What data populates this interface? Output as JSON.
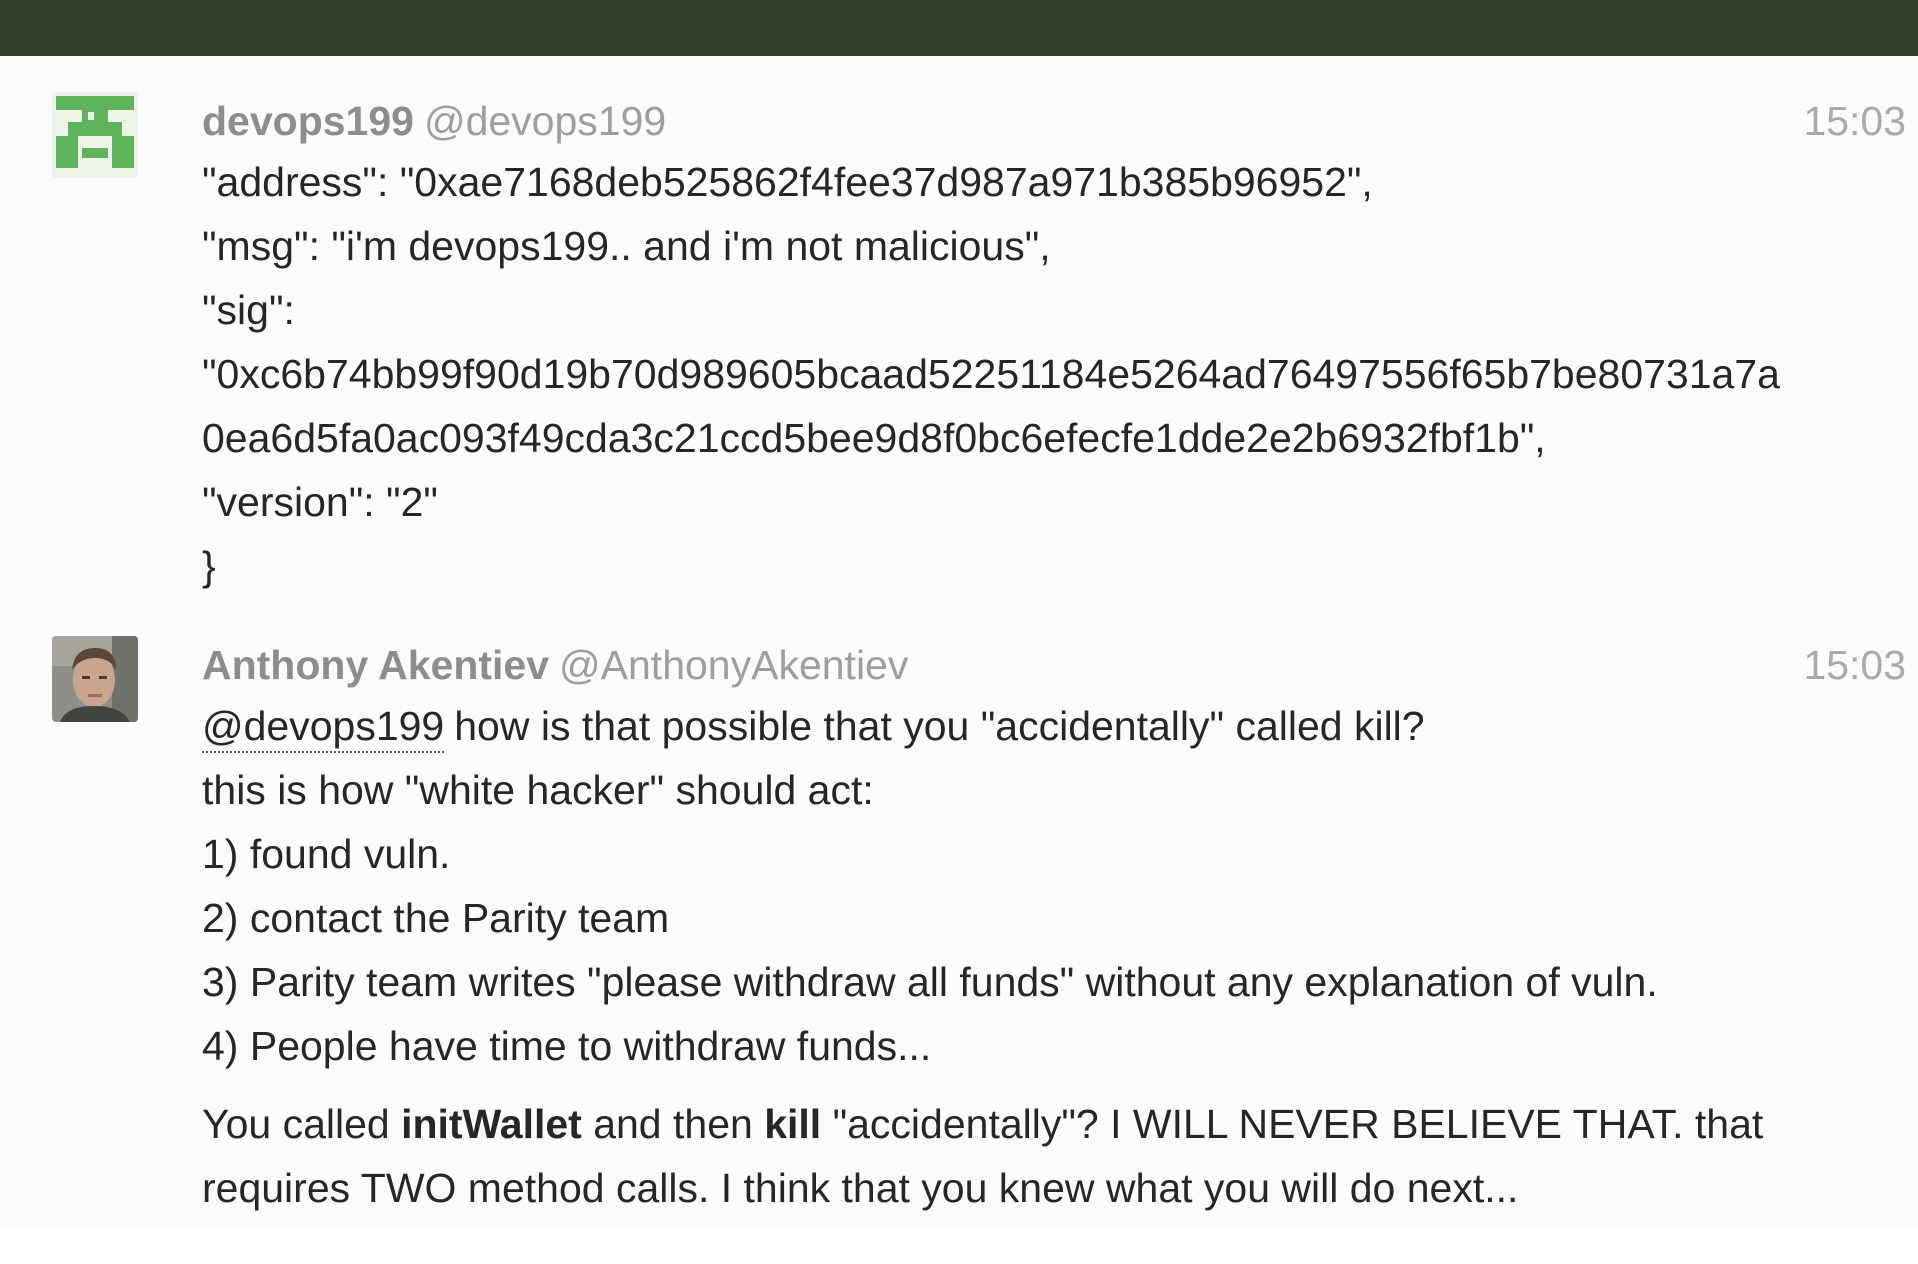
{
  "messages": [
    {
      "username": "devops199",
      "handle": "@devops199",
      "time": "15:03",
      "avatar": "identicon-avatar",
      "lines": [
        "\"address\": \"0xae7168deb525862f4fee37d987a971b385b96952\",",
        "\"msg\": \"i'm devops199.. and i'm not malicious\",",
        "\"sig\":",
        "\"0xc6b74bb99f90d19b70d989605bcaad52251184e5264ad76497556f65b7be80731a7a",
        "0ea6d5fa0ac093f49cda3c21ccd5bee9d8f0bc6efecfe1dde2e2b6932fbf1b\",",
        "\"version\": \"2\"",
        "}"
      ]
    },
    {
      "username": "Anthony Akentiev",
      "handle": "@AnthonyAkentiev",
      "time": "15:03",
      "avatar": "user-photo-avatar",
      "mention": "@devops199",
      "first_line_rest": "how is that possible that you \"accidentally\" called kill?",
      "lines": [
        "this is how \"white hacker\" should act:",
        "1) found vuln.",
        "2) contact the Parity team",
        "3) Parity team writes \"please withdraw all funds\" without any explanation of vuln.",
        "4) People have time to withdraw funds..."
      ],
      "para": {
        "seg1": "You called ",
        "bold1": "initWallet",
        "seg2": " and then ",
        "bold2": "kill",
        "seg3": " \"accidentally\"? I WILL NEVER BELIEVE THAT. that",
        "line2": "requires TWO method calls. I think that you knew what you will do next..."
      }
    }
  ]
}
